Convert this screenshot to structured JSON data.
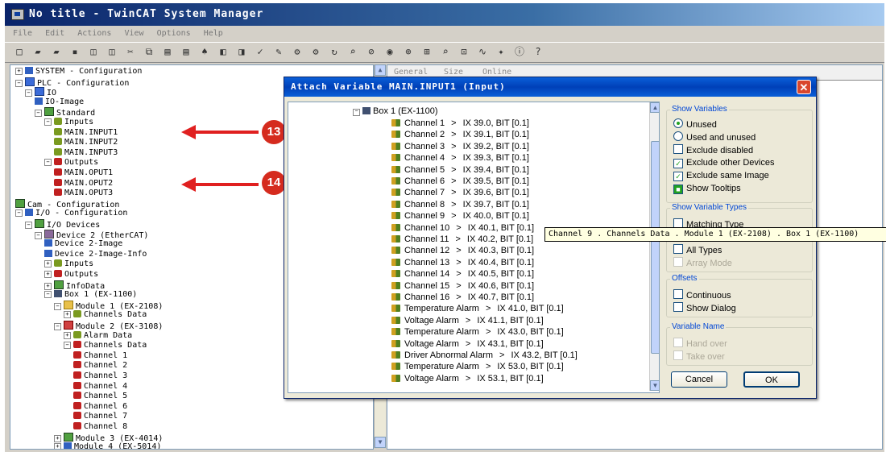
{
  "window": {
    "title": "No title - TwinCAT System Manager"
  },
  "menubar": [
    "File",
    "Edit",
    "Actions",
    "View",
    "Options",
    "Help"
  ],
  "toolbar_icons": [
    "new-icon",
    "open-icon",
    "open-remote-icon",
    "save-icon",
    "print-preview-icon",
    "print-icon",
    "cut-icon",
    "copy-icon",
    "paste-icon",
    "paste-with-links-icon",
    "find-icon",
    "replace-icon",
    "generate-mappings-icon",
    "check-configuration-icon",
    "activate-configuration-icon",
    "set-run-mode-icon",
    "set-config-mode-icon",
    "reload-devices-icon",
    "scan-devices-icon",
    "toggle-free-run-icon",
    "network-icon",
    "link-icon",
    "zoom-icon",
    "find-item-icon",
    "show-online-data-icon",
    "oscilloscope-icon",
    "target-system-icon",
    "info-icon",
    "help-icon"
  ],
  "tree": [
    {
      "label": "SYSTEM - Configuration",
      "icon": "system-icon"
    },
    {
      "label": "PLC - Configuration",
      "icon": "plc-icon"
    },
    {
      "label": "IO",
      "icon": "plc-project-icon"
    },
    {
      "label": "IO-Image",
      "icon": "process-image-icon"
    },
    {
      "label": "Standard",
      "icon": "task-icon"
    },
    {
      "label": "Inputs",
      "icon": "inputs-icon"
    },
    {
      "label": "MAIN.INPUT1",
      "icon": "input-var-icon"
    },
    {
      "label": "MAIN.INPUT2",
      "icon": "input-var-icon"
    },
    {
      "label": "MAIN.INPUT3",
      "icon": "input-var-icon"
    },
    {
      "label": "Outputs",
      "icon": "outputs-icon"
    },
    {
      "label": "MAIN.OPUT1",
      "icon": "output-var-icon"
    },
    {
      "label": "MAIN.OPUT2",
      "icon": "output-var-icon"
    },
    {
      "label": "MAIN.OPUT3",
      "icon": "output-var-icon"
    },
    {
      "label": "Cam - Configuration",
      "icon": "cam-icon"
    },
    {
      "label": "I/O - Configuration",
      "icon": "io-config-icon"
    },
    {
      "label": "I/O Devices",
      "icon": "io-devices-icon"
    },
    {
      "label": "Device 2 (EtherCAT)",
      "icon": "ethercat-device-icon"
    },
    {
      "label": "Device 2-Image",
      "icon": "process-image-icon"
    },
    {
      "label": "Device 2-Image-Info",
      "icon": "process-image-icon"
    },
    {
      "label": "Inputs",
      "icon": "inputs-icon"
    },
    {
      "label": "Outputs",
      "icon": "outputs-icon"
    },
    {
      "label": "InfoData",
      "icon": "infodata-icon"
    },
    {
      "label": "Box 1 (EX-1100)",
      "icon": "box-icon"
    },
    {
      "label": "Module 1 (EX-2108)",
      "icon": "module-icon"
    },
    {
      "label": "Channels Data",
      "icon": "inputs-icon"
    },
    {
      "label": "Module 2 (EX-3108)",
      "icon": "module-icon"
    },
    {
      "label": "Alarm Data",
      "icon": "inputs-icon"
    },
    {
      "label": "Channels Data",
      "icon": "outputs-icon"
    },
    {
      "label": "Channel 1",
      "icon": "output-var-icon"
    },
    {
      "label": "Channel 2",
      "icon": "output-var-icon"
    },
    {
      "label": "Channel 3",
      "icon": "output-var-icon"
    },
    {
      "label": "Channel 4",
      "icon": "output-var-icon"
    },
    {
      "label": "Channel 5",
      "icon": "output-var-icon"
    },
    {
      "label": "Channel 6",
      "icon": "output-var-icon"
    },
    {
      "label": "Channel 7",
      "icon": "output-var-icon"
    },
    {
      "label": "Channel 8",
      "icon": "output-var-icon"
    },
    {
      "label": "Module 3 (EX-4014)",
      "icon": "module-icon"
    },
    {
      "label": "Module 4 (EX-5014)",
      "icon": "module-icon"
    }
  ],
  "annotations": [
    {
      "number": "13"
    },
    {
      "number": "14"
    }
  ],
  "right_tabs": [
    "General",
    "Size",
    "Online"
  ],
  "dialog": {
    "title": "Attach Variable MAIN.INPUT1 (Input)",
    "box": "Box 1 (EX-1100)",
    "variables": [
      {
        "name": "Channel 1",
        "address": "IX 39.0, BIT [0.1]"
      },
      {
        "name": "Channel 2",
        "address": "IX 39.1, BIT [0.1]"
      },
      {
        "name": "Channel 3",
        "address": "IX 39.2, BIT [0.1]"
      },
      {
        "name": "Channel 4",
        "address": "IX 39.3, BIT [0.1]"
      },
      {
        "name": "Channel 5",
        "address": "IX 39.4, BIT [0.1]"
      },
      {
        "name": "Channel 6",
        "address": "IX 39.5, BIT [0.1]"
      },
      {
        "name": "Channel 7",
        "address": "IX 39.6, BIT [0.1]"
      },
      {
        "name": "Channel 8",
        "address": "IX 39.7, BIT [0.1]"
      },
      {
        "name": "Channel 9",
        "address": "IX 40.0, BIT [0.1]"
      },
      {
        "name": "Channel 10",
        "address": "IX 40.1, BIT [0.1]"
      },
      {
        "name": "Channel 11",
        "address": "IX 40.2, BIT [0.1]"
      },
      {
        "name": "Channel 12",
        "address": "IX 40.3, BIT [0.1]"
      },
      {
        "name": "Channel 13",
        "address": "IX 40.4, BIT [0.1]"
      },
      {
        "name": "Channel 14",
        "address": "IX 40.5, BIT [0.1]"
      },
      {
        "name": "Channel 15",
        "address": "IX 40.6, BIT [0.1]"
      },
      {
        "name": "Channel 16",
        "address": "IX 40.7, BIT [0.1]"
      },
      {
        "name": "Temperature Alarm",
        "address": "IX 41.0, BIT [0.1]"
      },
      {
        "name": "Voltage Alarm",
        "address": "IX 41.1, BIT [0.1]"
      },
      {
        "name": "Temperature Alarm",
        "address": "IX 43.0, BIT [0.1]"
      },
      {
        "name": "Voltage Alarm",
        "address": "IX 43.1, BIT [0.1]"
      },
      {
        "name": "Driver Abnormal Alarm",
        "address": "IX 43.2, BIT [0.1]"
      },
      {
        "name": "Temperature Alarm",
        "address": "IX 53.0, BIT [0.1]"
      },
      {
        "name": "Voltage Alarm",
        "address": "IX 53.1, BIT [0.1]"
      }
    ],
    "separator": ">",
    "tooltip": "Channel 9 . Channels Data . Module 1 (EX-2108) . Box 1 (EX-1100)",
    "show_variables": {
      "title": "Show Variables",
      "unused": "Unused",
      "used_and_unused": "Used and unused",
      "exclude_disabled": "Exclude disabled",
      "exclude_other_devices": "Exclude other Devices",
      "exclude_same_image": "Exclude same Image",
      "show_tooltips": "Show Tooltips"
    },
    "show_variable_types": {
      "title": "Show Variable Types",
      "matching_type": "Matching Type",
      "all_types": "All Types",
      "array_mode": "Array Mode"
    },
    "offsets": {
      "title": "Offsets",
      "continuous": "Continuous",
      "show_dialog": "Show Dialog"
    },
    "variable_name": {
      "title": "Variable Name",
      "hand_over": "Hand over",
      "take_over": "Take over"
    },
    "buttons": {
      "cancel": "Cancel",
      "ok": "OK"
    },
    "state": {
      "show_variables_selected": "unused",
      "exclude_disabled": false,
      "exclude_other_devices": true,
      "exclude_same_image": true,
      "show_tooltips": true,
      "matching_type": false,
      "all_types": false,
      "continuous": false,
      "show_dialog": false
    }
  }
}
